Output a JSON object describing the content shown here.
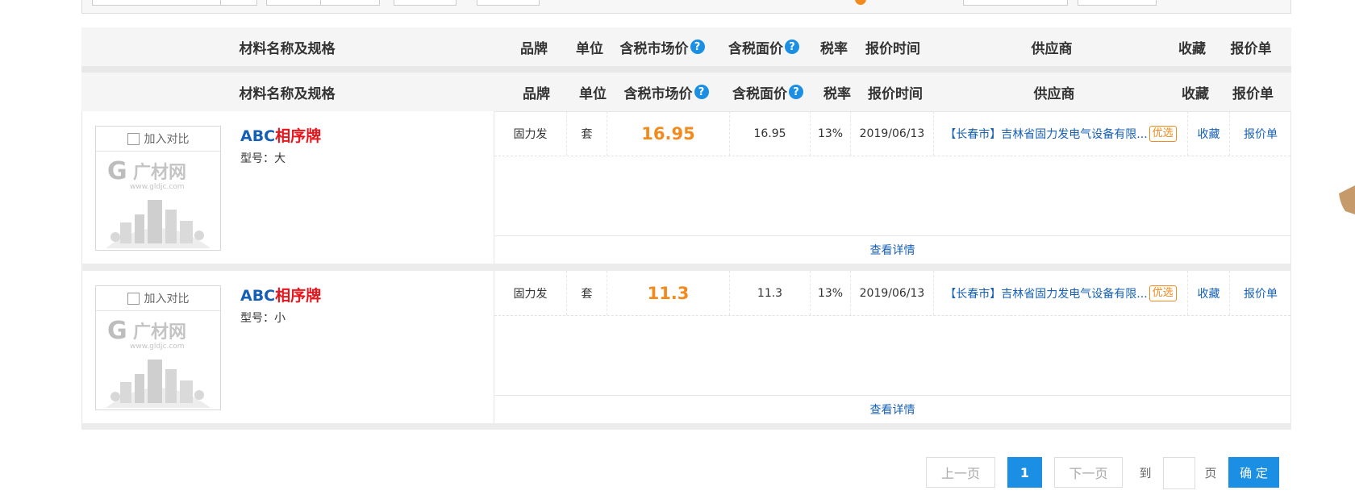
{
  "header": {
    "name": "材料名称及规格",
    "brand": "品牌",
    "unit": "单位",
    "market_price": "含税市场价",
    "face_price": "含税面价",
    "tax_rate": "税率",
    "quote_time": "报价时间",
    "supplier": "供应商",
    "favorite": "收藏",
    "quote_sheet": "报价单",
    "help_glyph": "?"
  },
  "products": [
    {
      "compare_label": "加入对比",
      "name_brand": "ABC",
      "name_rest": "相序牌",
      "model": "型号：大",
      "brand": "固力发",
      "unit": "套",
      "market_price": "16.95",
      "face_price": "16.95",
      "tax_rate": "13%",
      "quote_time": "2019/06/13",
      "supplier": "【长春市】吉林省固力发电气设备有限...",
      "badge": "优选",
      "favorite": "收藏",
      "quote_sheet": "报价单",
      "detail": "查看详情"
    },
    {
      "compare_label": "加入对比",
      "name_brand": "ABC",
      "name_rest": "相序牌",
      "model": "型号：小",
      "brand": "固力发",
      "unit": "套",
      "market_price": "11.3",
      "face_price": "11.3",
      "tax_rate": "13%",
      "quote_time": "2019/06/13",
      "supplier": "【长春市】吉林省固力发电气设备有限...",
      "badge": "优选",
      "favorite": "收藏",
      "quote_sheet": "报价单",
      "detail": "查看详情"
    }
  ],
  "logo": {
    "text": "广材网",
    "url_text": "www.gldjc.com"
  },
  "pagination": {
    "prev": "上一页",
    "current": "1",
    "next": "下一页",
    "goto": "到",
    "page": "页",
    "confirm": "确 定"
  },
  "colors": {
    "accent_blue": "#1a8fe3",
    "link_blue": "#1560b6",
    "price_orange": "#f28a1e",
    "name_red": "#e8141b"
  }
}
